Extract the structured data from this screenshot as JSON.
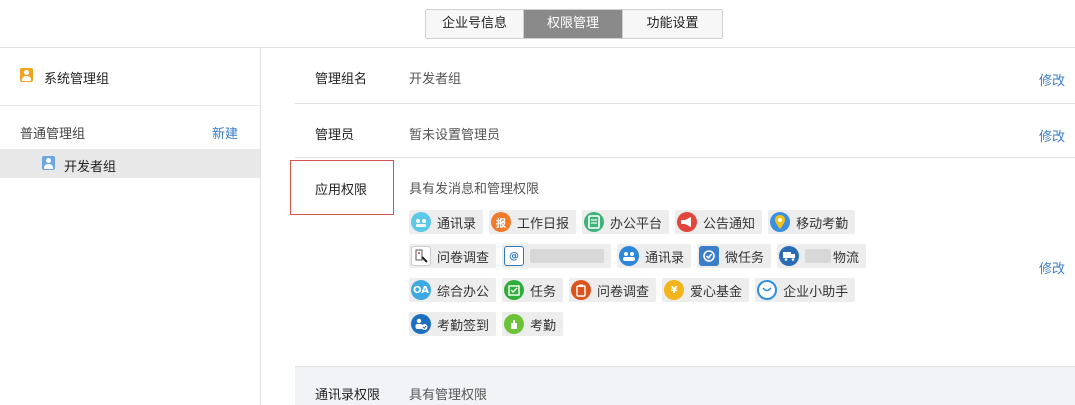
{
  "tabs": [
    {
      "label": "企业号信息",
      "active": false
    },
    {
      "label": "权限管理",
      "active": true
    },
    {
      "label": "功能设置",
      "active": false
    }
  ],
  "sidebar": {
    "system_group": "系统管理组",
    "normal_group_title": "普通管理组",
    "new_label": "新建",
    "selected_item": "开发者组"
  },
  "main": {
    "group_name": {
      "label": "管理组名",
      "value": "开发者组",
      "edit": "修改"
    },
    "admin": {
      "label": "管理员",
      "value": "暂未设置管理员",
      "edit": "修改"
    },
    "app_perm": {
      "label": "应用权限",
      "value": "具有发消息和管理权限",
      "edit": "修改",
      "apps": [
        [
          {
            "name": "通讯录",
            "icon": "contacts-icon",
            "color": "#5cc8e8"
          },
          {
            "name": "工作日报",
            "icon": "report-icon",
            "color": "#f07b2a"
          },
          {
            "name": "办公平台",
            "icon": "document-icon",
            "color": "#3db37a"
          },
          {
            "name": "公告通知",
            "icon": "megaphone-icon",
            "color": "#e2463a"
          },
          {
            "name": "移动考勤",
            "icon": "location-pin-icon",
            "color": "#3b8fe0"
          }
        ],
        [
          {
            "name": "问卷调查",
            "icon": "questionnaire-icon",
            "color": "#555555"
          },
          {
            "name": "",
            "icon": "email-icon",
            "color": "#2a78c8"
          },
          {
            "name": "通讯录",
            "icon": "people-icon",
            "color": "#2d86d9"
          },
          {
            "name": "微任务",
            "icon": "task-check-icon",
            "color": "#3a7dc9"
          },
          {
            "name": "物流",
            "icon": "truck-icon",
            "color": "#2a6bb5"
          }
        ],
        [
          {
            "name": "综合办公",
            "icon": "oa-icon",
            "color": "#3ea8e0"
          },
          {
            "name": "任务",
            "icon": "board-icon",
            "color": "#2fae3b"
          },
          {
            "name": "问卷调查",
            "icon": "clipboard-icon",
            "color": "#d9541e"
          },
          {
            "name": "爱心基金",
            "icon": "coin-icon",
            "color": "#f2b41a"
          },
          {
            "name": "企业小助手",
            "icon": "chat-bubble-icon",
            "color": "#2d8fe0"
          }
        ],
        [
          {
            "name": "考勤签到",
            "icon": "checkin-icon",
            "color": "#1c6fc0"
          },
          {
            "name": "考勤",
            "icon": "hand-icon",
            "color": "#6cc33a"
          }
        ]
      ]
    },
    "contacts_perm": {
      "label": "通讯录权限",
      "value": "具有管理权限"
    }
  }
}
